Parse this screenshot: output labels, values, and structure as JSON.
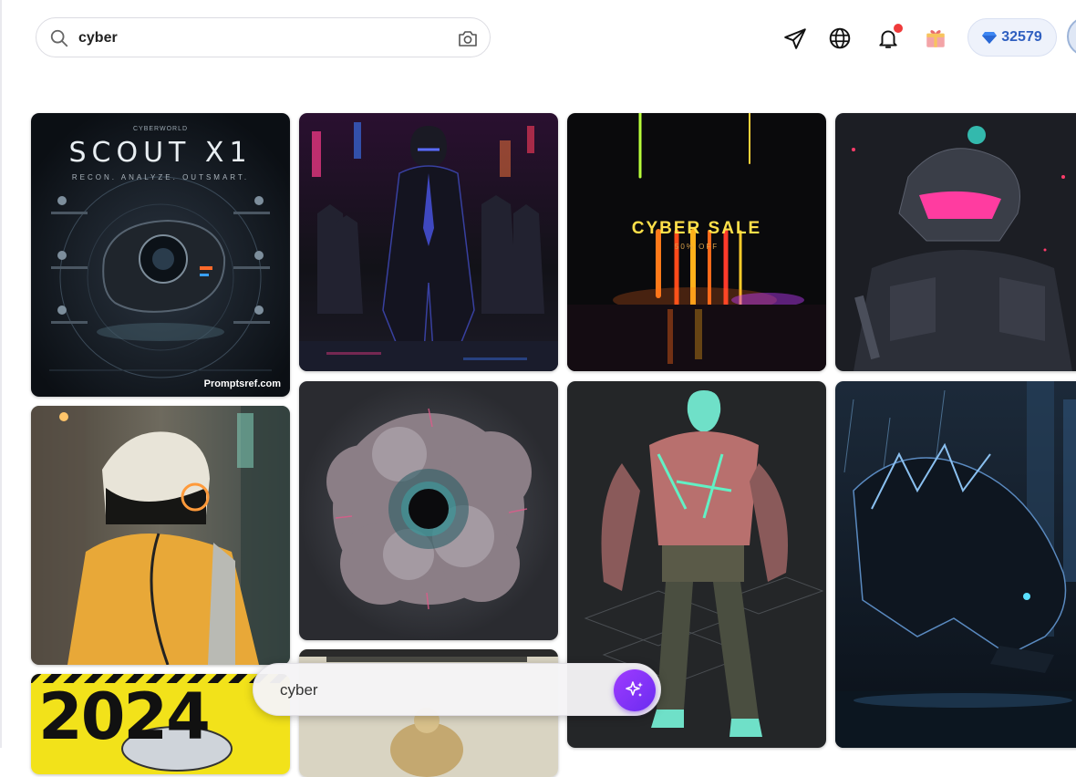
{
  "search": {
    "query": "cyber",
    "placeholder": ""
  },
  "header": {
    "credits": "32579",
    "icons": [
      "send-icon",
      "globe-icon",
      "bell-icon",
      "gift-icon",
      "diamond-icon",
      "avatar"
    ],
    "notification_dot_color": "#ef3b3b"
  },
  "gallery": {
    "cards": [
      {
        "name": "scout-x1-poster",
        "title": "SCOUT X1",
        "kicker": "CYBERWORLD",
        "subtitle": "RECON. ANALYZE. OUTSMART.",
        "watermark": "Promptsref.com"
      },
      {
        "name": "cyber-trench-coat-walker"
      },
      {
        "name": "cyber-sale",
        "title": "CYBER SALE",
        "subtitle": "50% OFF"
      },
      {
        "name": "cyber-soldier-mask"
      },
      {
        "name": "helmet-yellow-jacket"
      },
      {
        "name": "cyber-eye-cloud"
      },
      {
        "name": "cyber-warrior-3d"
      },
      {
        "name": "cyber-panther"
      },
      {
        "name": "2024-poster",
        "title": "2024"
      },
      {
        "name": "golden-figure"
      }
    ]
  },
  "prompt_bar": {
    "text": "cyber"
  },
  "colors": {
    "accent": "#7b2ff7",
    "credits_text": "#2f5fc0"
  }
}
